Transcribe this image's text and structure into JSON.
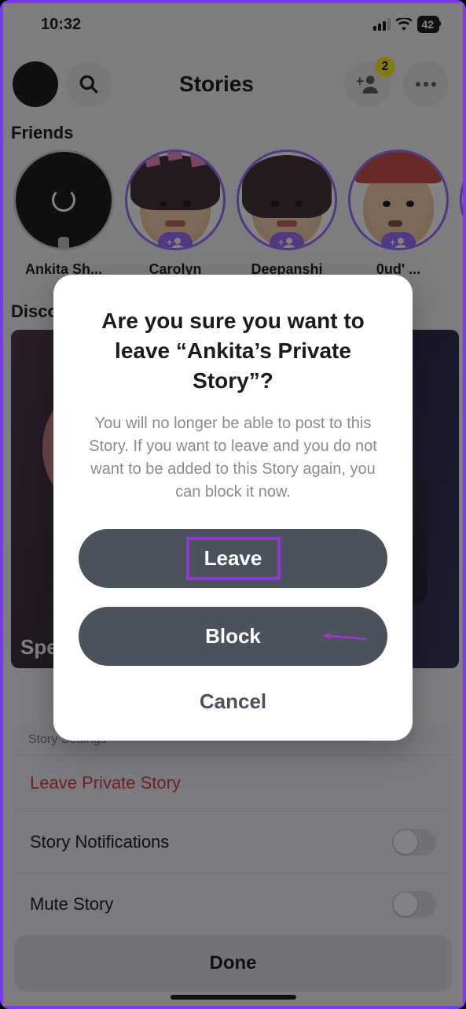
{
  "status": {
    "time": "10:32",
    "battery": "42"
  },
  "header": {
    "title": "Stories",
    "badge_count": "2"
  },
  "sections": {
    "friends_label": "Friends",
    "discover_label": "Discover"
  },
  "stories": [
    {
      "name": "Ankita Sh..."
    },
    {
      "name": "Carolyn"
    },
    {
      "name": "Deepanshi"
    },
    {
      "name": "0ud' ..."
    },
    {
      "name": ""
    }
  ],
  "discover": {
    "tile1_text": "Spe...\nde...",
    "tile2_text": ""
  },
  "sheet": {
    "header": "Story Settings",
    "leave": "Leave Private Story",
    "notifications": "Story Notifications",
    "mute": "Mute Story",
    "done": "Done"
  },
  "modal": {
    "title": "Are you sure you want to leave “Ankita’s Private Story”?",
    "body": "You will no longer be able to post to this Story. If you want to leave and you do not want to be added to this Story again, you can block it now.",
    "leave": "Leave",
    "block": "Block",
    "cancel": "Cancel"
  }
}
